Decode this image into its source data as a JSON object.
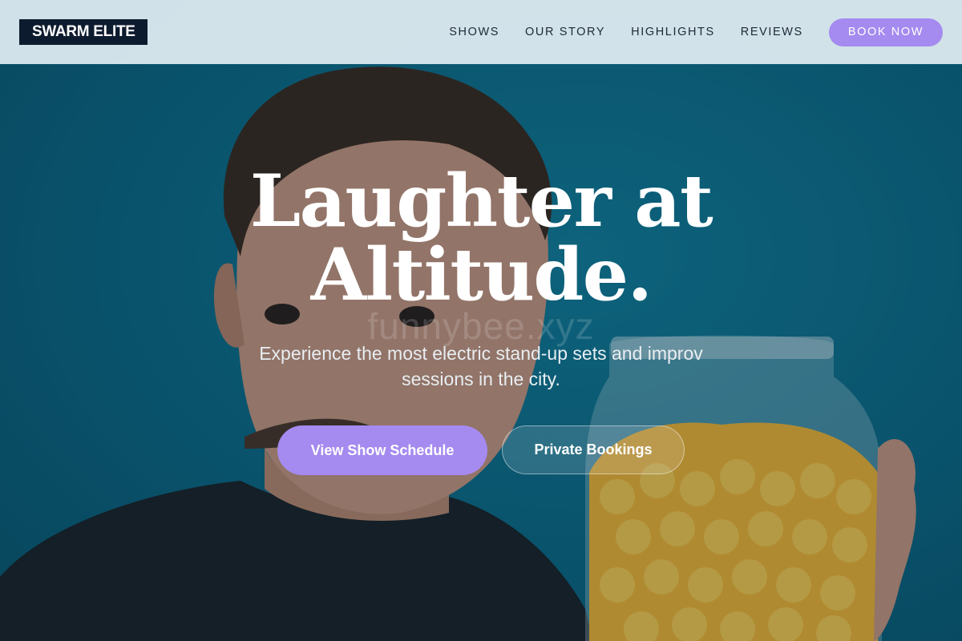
{
  "brand": {
    "logo_text": "SWARM ELITE"
  },
  "nav": {
    "links": [
      "SHOWS",
      "OUR STORY",
      "HIGHLIGHTS",
      "REVIEWS"
    ],
    "book_label": "BOOK NOW"
  },
  "hero": {
    "headline": "Laughter at Altitude.",
    "subtitle": "Experience the most electric stand-up sets and improv sessions in the city.",
    "primary_cta": "View Show Schedule",
    "secondary_cta": "Private Bookings",
    "watermark": "funnybee.xyz"
  },
  "colors": {
    "accent": "#a58af0",
    "logo_bg": "#0d1b2e",
    "nav_bg": "#deebf1",
    "hero_bg": "#0e6a86"
  },
  "images": {
    "hero_photo": "man-holding-jar-of-yellow-candy"
  }
}
